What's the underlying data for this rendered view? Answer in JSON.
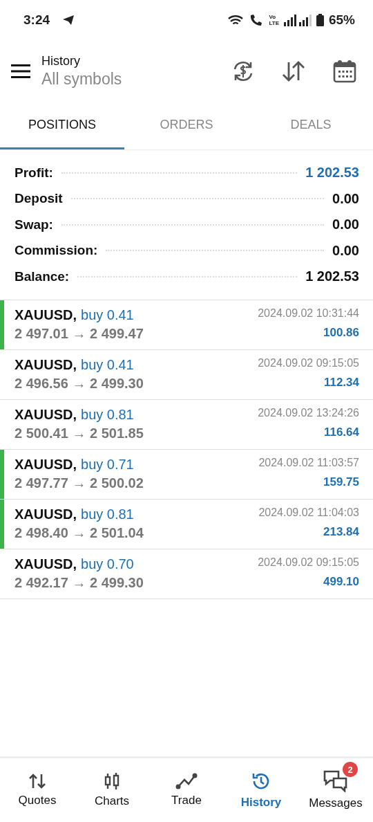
{
  "status_bar": {
    "time": "3:24",
    "volte": "Vo\nLTE",
    "battery": "65%"
  },
  "header": {
    "title": "History",
    "subtitle": "All symbols"
  },
  "tabs": [
    {
      "label": "POSITIONS",
      "selected": true
    },
    {
      "label": "ORDERS",
      "selected": false
    },
    {
      "label": "DEALS",
      "selected": false
    }
  ],
  "summary": [
    {
      "label": "Profit:",
      "value": "1 202.53",
      "kind": "accent"
    },
    {
      "label": "Deposit",
      "value": "0.00",
      "kind": "plain"
    },
    {
      "label": "Swap:",
      "value": "0.00",
      "kind": "plain"
    },
    {
      "label": "Commission:",
      "value": "0.00",
      "kind": "plain"
    },
    {
      "label": "Balance:",
      "value": "1 202.53",
      "kind": "plain"
    }
  ],
  "positions": [
    {
      "symbol": "XAUUSD,",
      "trade": "buy 0.41",
      "prices": "2 497.01 → 2 499.47",
      "time": "2024.09.02 10:31:44",
      "profit": "100.86",
      "marked": true
    },
    {
      "symbol": "XAUUSD,",
      "trade": "buy 0.41",
      "prices": "2 496.56 → 2 499.30",
      "time": "2024.09.02 09:15:05",
      "profit": "112.34",
      "marked": false
    },
    {
      "symbol": "XAUUSD,",
      "trade": "buy 0.81",
      "prices": "2 500.41 → 2 501.85",
      "time": "2024.09.02 13:24:26",
      "profit": "116.64",
      "marked": false
    },
    {
      "symbol": "XAUUSD,",
      "trade": "buy 0.71",
      "prices": "2 497.77 → 2 500.02",
      "time": "2024.09.02 11:03:57",
      "profit": "159.75",
      "marked": true
    },
    {
      "symbol": "XAUUSD,",
      "trade": "buy 0.81",
      "prices": "2 498.40 → 2 501.04",
      "time": "2024.09.02 11:04:03",
      "profit": "213.84",
      "marked": true
    },
    {
      "symbol": "XAUUSD,",
      "trade": "buy 0.70",
      "prices": "2 492.17 → 2 499.30",
      "time": "2024.09.02 09:15:05",
      "profit": "499.10",
      "marked": false
    }
  ],
  "bottom_nav": [
    {
      "label": "Quotes",
      "kind": "quotes",
      "selected": false
    },
    {
      "label": "Charts",
      "kind": "charts",
      "selected": false
    },
    {
      "label": "Trade",
      "kind": "trade",
      "selected": false
    },
    {
      "label": "History",
      "kind": "history",
      "selected": true
    },
    {
      "label": "Messages",
      "kind": "messages",
      "selected": false,
      "badge": "2"
    }
  ]
}
